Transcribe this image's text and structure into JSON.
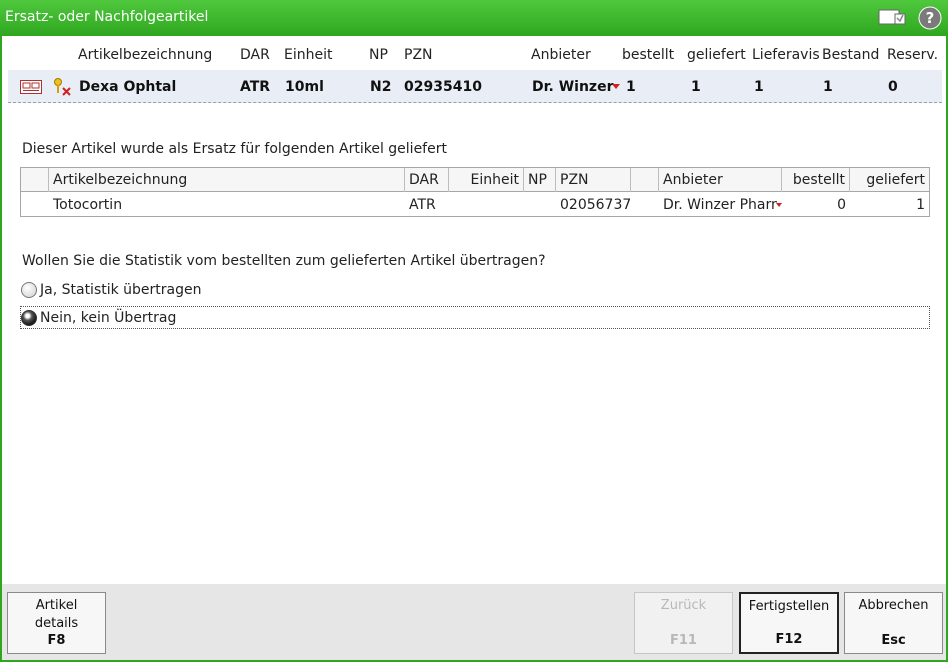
{
  "window": {
    "title": "Ersatz- oder Nachfolgeartikel"
  },
  "article_header": {
    "columns": [
      "Artikelbezeichnung",
      "DAR",
      "Einheit",
      "NP",
      "PZN",
      "Anbieter",
      "bestellt",
      "geliefert",
      "Lieferavis",
      "Bestand",
      "Reserv."
    ]
  },
  "article_row": {
    "name": "Dexa Ophtal",
    "dar": "ATR",
    "einheit": "10ml",
    "np": "N2",
    "pzn": "02935410",
    "anbieter": "Dr. Winzer P",
    "bestellt": "1",
    "geliefert": "1",
    "lieferavis": "1",
    "bestand": "1",
    "reserv": "0"
  },
  "replacement_section": {
    "caption": "Dieser Artikel wurde als Ersatz für folgenden Artikel geliefert",
    "columns": [
      "Artikelbezeichnung",
      "DAR",
      "Einheit",
      "NP",
      "PZN",
      "Anbieter",
      "bestellt",
      "geliefert"
    ],
    "row": {
      "name": "Totocortin",
      "dar": "ATR",
      "einheit": "",
      "np": "",
      "pzn": "02056737",
      "anbieter": "Dr. Winzer Pharm",
      "bestellt": "0",
      "geliefert": "1"
    }
  },
  "statistics": {
    "question": "Wollen Sie die Statistik vom bestellten zum gelieferten Artikel übertragen?",
    "options": [
      {
        "label": "Ja, Statistik übertragen",
        "selected": false
      },
      {
        "label": "Nein, kein Übertrag",
        "selected": true
      }
    ]
  },
  "buttons": {
    "details": {
      "line1": "Artikel",
      "line2": "details",
      "key": "F8"
    },
    "back": {
      "label": "Zurück",
      "key": "F11"
    },
    "finish": {
      "label": "Fertigstellen",
      "key": "F12"
    },
    "cancel": {
      "label": "Abbrechen",
      "key": "Esc"
    }
  },
  "colors": {
    "titlebar": "#2fa61f",
    "row_highlight": "#e8edf6"
  }
}
